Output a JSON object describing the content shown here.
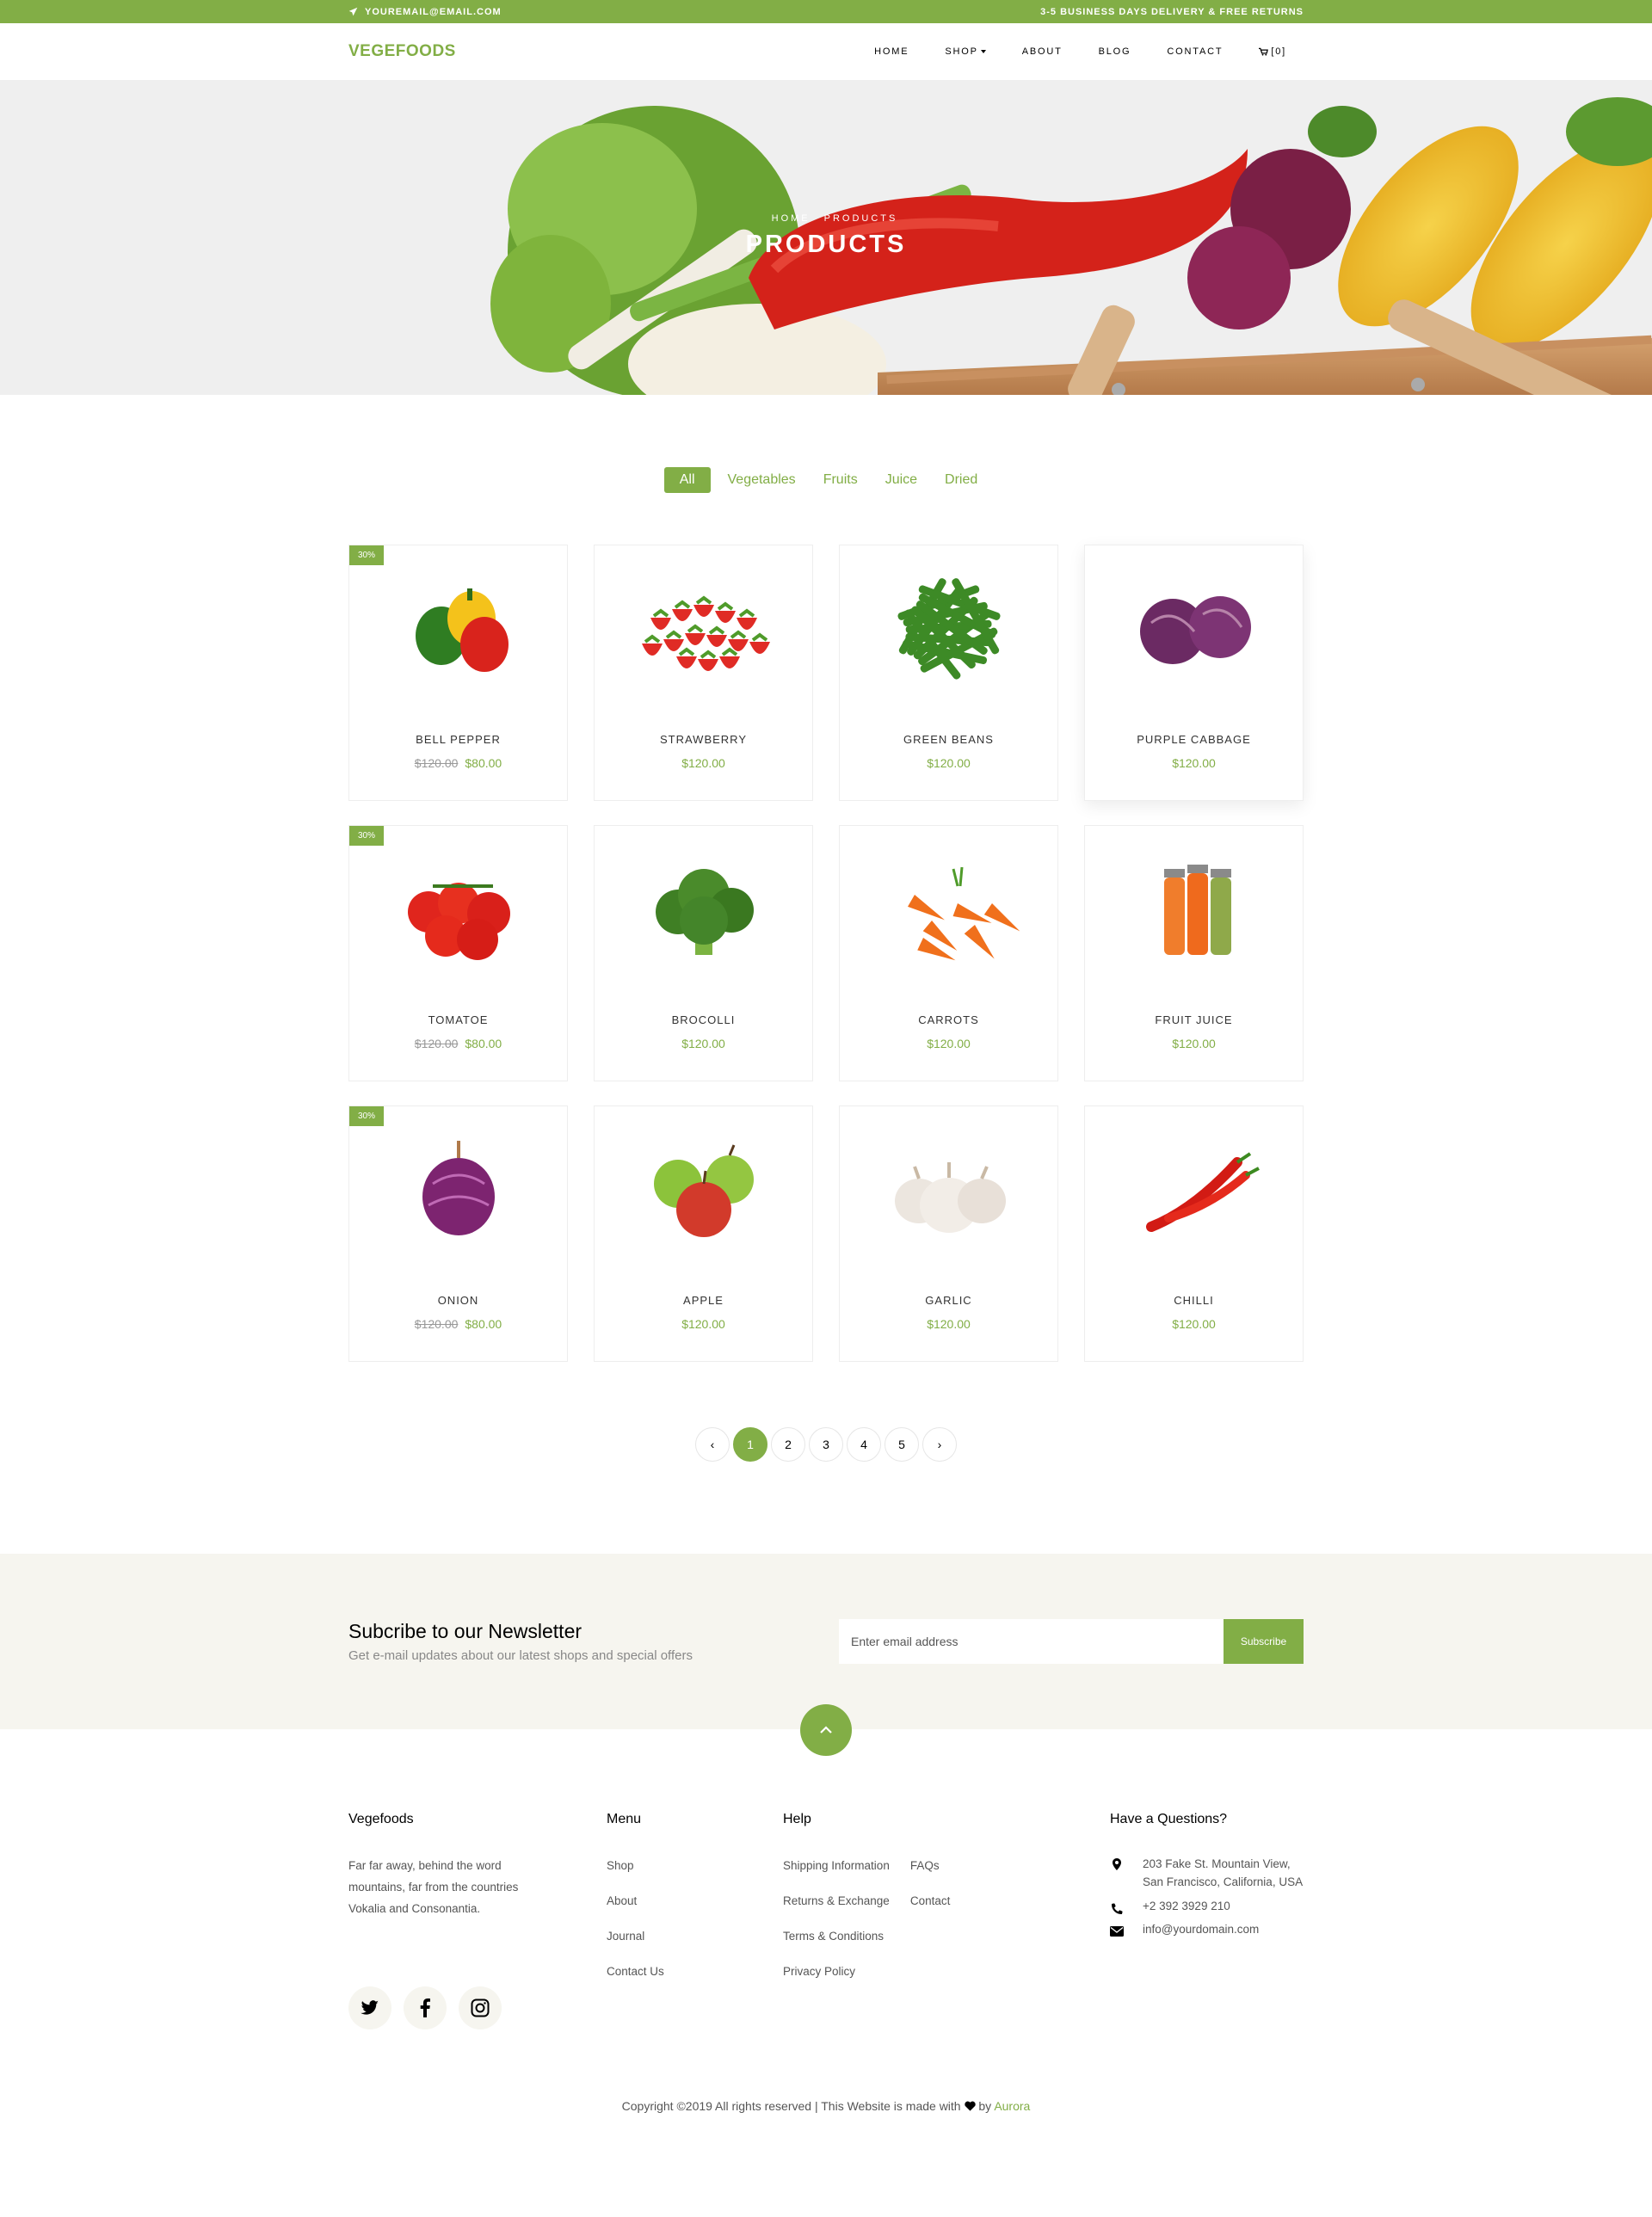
{
  "topbar": {
    "email": "YOUREMAIL@EMAIL.COM",
    "shipping": "3-5 BUSINESS DAYS DELIVERY & FREE RETURNS"
  },
  "nav": {
    "logo": "VEGEFOODS",
    "items": [
      "HOME",
      "SHOP",
      "ABOUT",
      "BLOG",
      "CONTACT"
    ],
    "cart": "[0]"
  },
  "hero": {
    "breadcrumb_home": "HOME",
    "breadcrumb_current": "PRODUCTS",
    "title": "PRODUCTS"
  },
  "filters": [
    "All",
    "Vegetables",
    "Fruits",
    "Juice",
    "Dried"
  ],
  "products": [
    {
      "name": "BELL PEPPER",
      "badge": "30%",
      "old_price": "$120.00",
      "price": "$80.00",
      "icon": "bell-pepper-image"
    },
    {
      "name": "STRAWBERRY",
      "badge": "",
      "old_price": "",
      "price": "$120.00",
      "icon": "strawberry-image"
    },
    {
      "name": "GREEN BEANS",
      "badge": "",
      "old_price": "",
      "price": "$120.00",
      "icon": "green-beans-image"
    },
    {
      "name": "PURPLE CABBAGE",
      "badge": "",
      "old_price": "",
      "price": "$120.00",
      "icon": "purple-cabbage-image"
    },
    {
      "name": "TOMATOE",
      "badge": "30%",
      "old_price": "$120.00",
      "price": "$80.00",
      "icon": "tomato-image"
    },
    {
      "name": "BROCOLLI",
      "badge": "",
      "old_price": "",
      "price": "$120.00",
      "icon": "broccoli-image"
    },
    {
      "name": "CARROTS",
      "badge": "",
      "old_price": "",
      "price": "$120.00",
      "icon": "carrots-image"
    },
    {
      "name": "FRUIT JUICE",
      "badge": "",
      "old_price": "",
      "price": "$120.00",
      "icon": "fruit-juice-image"
    },
    {
      "name": "ONION",
      "badge": "30%",
      "old_price": "$120.00",
      "price": "$80.00",
      "icon": "onion-image"
    },
    {
      "name": "APPLE",
      "badge": "",
      "old_price": "",
      "price": "$120.00",
      "icon": "apple-image"
    },
    {
      "name": "GARLIC",
      "badge": "",
      "old_price": "",
      "price": "$120.00",
      "icon": "garlic-image"
    },
    {
      "name": "CHILLI",
      "badge": "",
      "old_price": "",
      "price": "$120.00",
      "icon": "chilli-image"
    }
  ],
  "pagination": {
    "prev": "‹",
    "pages": [
      "1",
      "2",
      "3",
      "4",
      "5"
    ],
    "next": "›",
    "current": "1"
  },
  "newsletter": {
    "title": "Subcribe to our Newsletter",
    "subtitle": "Get e-mail updates about our latest shops and special offers",
    "placeholder": "Enter email address",
    "button": "Subscribe"
  },
  "footer": {
    "about": {
      "title": "Vegefoods",
      "text": "Far far away, behind the word mountains, far from the countries Vokalia and Consonantia."
    },
    "menu": {
      "title": "Menu",
      "items": [
        "Shop",
        "About",
        "Journal",
        "Contact Us"
      ]
    },
    "help": {
      "title": "Help",
      "col1": [
        "Shipping Information",
        "Returns & Exchange",
        "Terms & Conditions",
        "Privacy Policy"
      ],
      "col2": [
        "FAQs",
        "Contact"
      ]
    },
    "contact": {
      "title": "Have a Questions?",
      "address": "203 Fake St. Mountain View, San Francisco, California, USA",
      "phone": "+2 392 3929 210",
      "email": "info@yourdomain.com"
    },
    "copyright_text": "Copyright ©2019 All rights reserved | This Website is made with",
    "copyright_by": "by",
    "copyright_brand": "Aurora"
  },
  "colors": {
    "accent": "#82ae46",
    "newsletter_bg": "#f6f5ef"
  }
}
